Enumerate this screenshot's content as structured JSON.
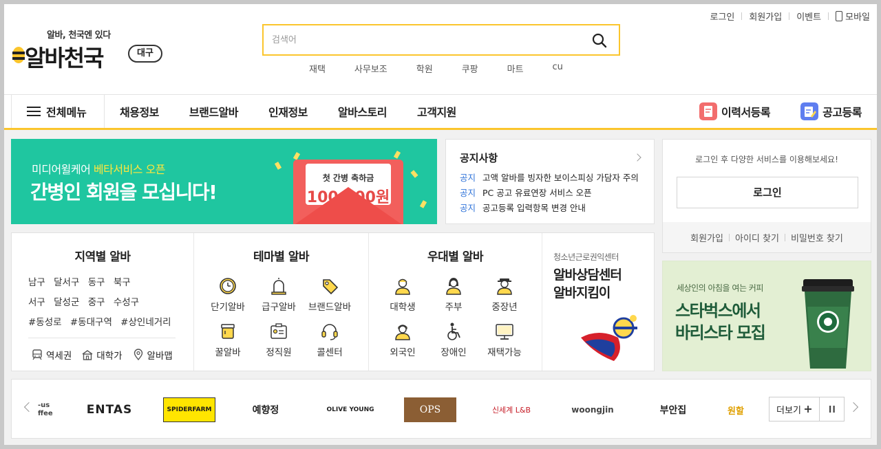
{
  "header": {
    "slogan": "알바, 천국엔 있다",
    "logo_name": "알바천국",
    "region": "대구",
    "search_placeholder": "검색어",
    "keywords": [
      "재택",
      "사무보조",
      "학원",
      "쿠팡",
      "마트",
      "cu"
    ],
    "util": [
      "로그인",
      "회원가입",
      "이벤트",
      "모바일"
    ]
  },
  "nav": {
    "all_menu": "전체메뉴",
    "links": [
      "채용정보",
      "브랜드알바",
      "인재정보",
      "알바스토리",
      "고객지원"
    ],
    "resume": "이력서등록",
    "post": "공고등록"
  },
  "banner": {
    "line1_prefix": "미디어윌케어 ",
    "line1_highlight": "베타서비스 오픈",
    "line2": "간병인 회원을 모십니다!",
    "card_top": "첫 간병 축하금",
    "card_amount": "100,000원"
  },
  "notice": {
    "title": "공지사항",
    "items": [
      {
        "tag": "공지",
        "text": "고액 알바를 빙자한 보이스피싱 가담자 주의"
      },
      {
        "tag": "공지",
        "text": "PC 공고 유료연장 서비스 오픈"
      },
      {
        "tag": "공지",
        "text": "공고등록 입력항목 변경 안내"
      }
    ]
  },
  "login": {
    "message": "로그인 후 다양한 서비스를 이용해보세요!",
    "button": "로그인",
    "links": [
      "회원가입",
      "아이디 찾기",
      "비밀번호 찾기"
    ]
  },
  "region": {
    "title": "지역별 알바",
    "rows": [
      [
        "남구",
        "달서구",
        "동구",
        "북구"
      ],
      [
        "서구",
        "달성군",
        "중구",
        "수성구"
      ],
      [
        "#동성로",
        "#동대구역",
        "#상인네거리"
      ]
    ],
    "bottom": [
      "역세권",
      "대학가",
      "알바맵"
    ]
  },
  "theme": {
    "title": "테마별 알바",
    "items": [
      "단기알바",
      "급구알바",
      "브랜드알바",
      "꿀알바",
      "정직원",
      "콜센터"
    ]
  },
  "perk": {
    "title": "우대별 알바",
    "items": [
      "대학생",
      "주부",
      "중장년",
      "외국인",
      "장애인",
      "재택가능"
    ]
  },
  "promo": {
    "sub": "청소년근로권익센터",
    "line1": "알바상담센터",
    "line2": "알바지킴이"
  },
  "starbucks": {
    "sub": "세상인의 아침을 여는 커피",
    "line1": "스타벅스에서",
    "line2": "바리스타 모집"
  },
  "brands": {
    "logos": [
      "-us ffee",
      "ENTAS",
      "SPIDERFARM",
      "예향정",
      "OLIVE YOUNG",
      "OPS",
      "신세계 L&B",
      "woongjin",
      "부안집",
      "원할"
    ],
    "more": "더보기"
  },
  "colors": {
    "accent": "#fbc52c",
    "banner_green": "#1fc6a0",
    "notice_tag": "#2f73d9"
  }
}
